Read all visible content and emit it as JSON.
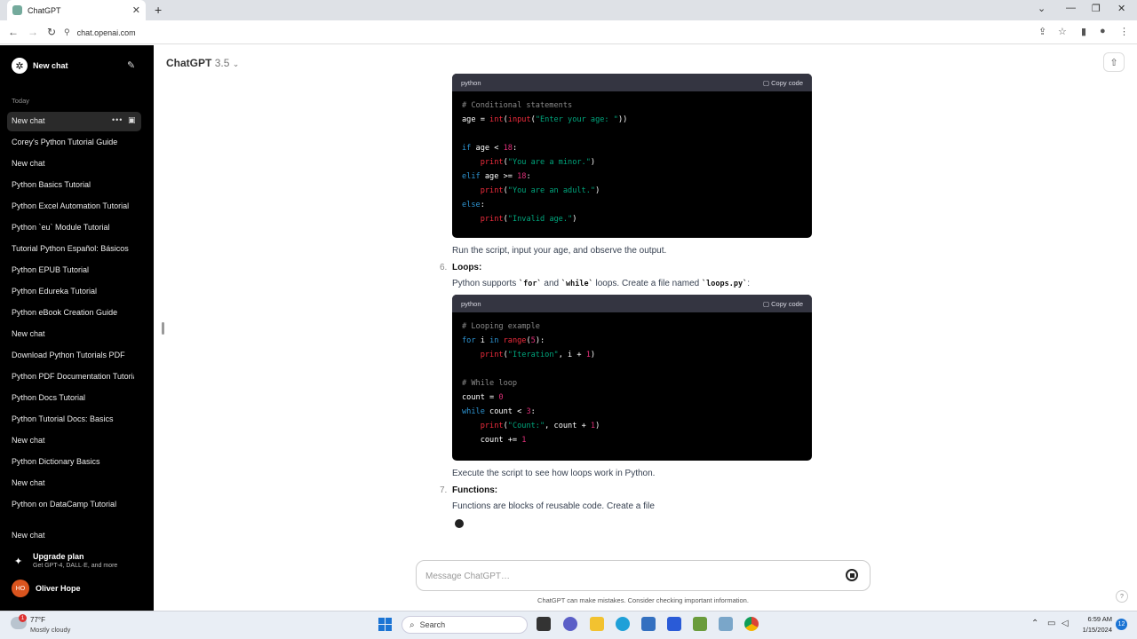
{
  "browser": {
    "tab_title": "ChatGPT",
    "url": "chat.openai.com"
  },
  "sidebar": {
    "new_chat_label": "New chat",
    "section_today": "Today",
    "items": [
      {
        "label": "New chat",
        "active": true
      },
      {
        "label": "Corey's Python Tutorial Guide"
      },
      {
        "label": "New chat"
      },
      {
        "label": "Python Basics Tutorial"
      },
      {
        "label": "Python Excel Automation Tutorial"
      },
      {
        "label": "Python `eu` Module Tutorial"
      },
      {
        "label": "Tutorial Python Español: Básicos"
      },
      {
        "label": "Python EPUB Tutorial"
      },
      {
        "label": "Python Edureka Tutorial"
      },
      {
        "label": "Python eBook Creation Guide"
      },
      {
        "label": "New chat"
      },
      {
        "label": "Download Python Tutorials PDF"
      },
      {
        "label": "Python PDF Documentation Tutorial"
      },
      {
        "label": "Python Docs Tutorial"
      },
      {
        "label": "Python Tutorial Docs: Basics"
      },
      {
        "label": "New chat"
      },
      {
        "label": "Python Dictionary Basics"
      },
      {
        "label": "New chat"
      },
      {
        "label": "Python on DataCamp Tutorial"
      },
      {
        "label": "New chat"
      }
    ],
    "upgrade_title": "Upgrade plan",
    "upgrade_subtitle": "Get GPT-4, DALL·E, and more",
    "user_initials": "HO",
    "user_name": "Oliver Hope"
  },
  "header": {
    "model_name": "ChatGPT",
    "model_version": "3.5"
  },
  "conversation": {
    "code1_lang": "python",
    "copy_label": "Copy code",
    "after_code1": "Run the script, input your age, and observe the output.",
    "step6_num": "6.",
    "step6_title": "Loops:",
    "step6_text_a": "Python supports ",
    "step6_code_for": "`for`",
    "step6_text_b": " and ",
    "step6_code_while": "`while`",
    "step6_text_c": " loops. Create a file named ",
    "step6_code_file": "`loops.py`",
    "step6_text_d": ":",
    "code2_lang": "python",
    "after_code2": "Execute the script to see how loops work in Python.",
    "step7_num": "7.",
    "step7_title": "Functions:",
    "step7_text": "Functions are blocks of reusable code. Create a file"
  },
  "composer": {
    "placeholder": "Message ChatGPT…",
    "disclaimer": "ChatGPT can make mistakes. Consider checking important information."
  },
  "taskbar": {
    "weather_badge": "1",
    "weather_temp": "77°F",
    "weather_desc": "Mostly cloudy",
    "search_label": "Search",
    "time": "6:59 AM",
    "date": "1/15/2024",
    "notifications": "12"
  }
}
